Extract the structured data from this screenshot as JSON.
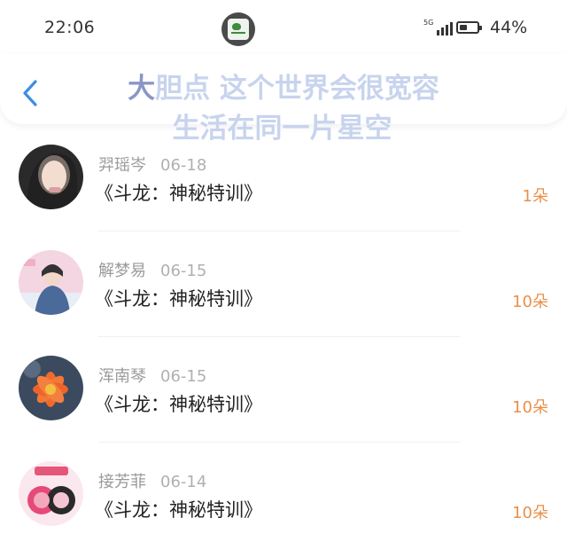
{
  "status_bar": {
    "time": "22:06",
    "network": "5G",
    "battery_percent": "44%",
    "battery_level": 0.44
  },
  "header": {
    "back_icon": "chevron-left-icon",
    "title_lead": "大",
    "title_line1_rest": "胆点 这个世界会很宽容",
    "title_line2": "生活在同一片星空"
  },
  "items": [
    {
      "name": "羿瑶岑",
      "date": "06-18",
      "work": "《斗龙：神秘特训》",
      "count": "1朵"
    },
    {
      "name": "解梦易",
      "date": "06-15",
      "work": "《斗龙：神秘特训》",
      "count": "10朵"
    },
    {
      "name": "浑南琴",
      "date": "06-15",
      "work": "《斗龙：神秘特训》",
      "count": "10朵"
    },
    {
      "name": "接芳菲",
      "date": "06-14",
      "work": "《斗龙：神秘特训》",
      "count": "10朵"
    }
  ],
  "colors": {
    "accent_blue": "#3a8ee6",
    "count_orange": "#e8904a",
    "title_overlay": "#c8d4ee"
  }
}
